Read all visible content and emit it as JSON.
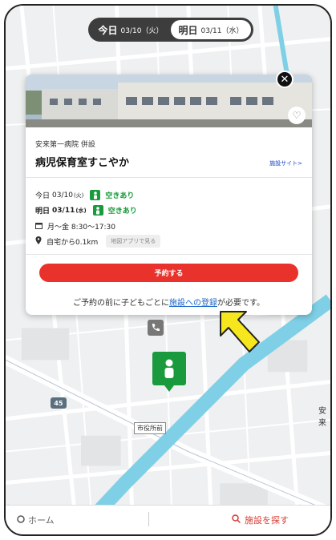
{
  "date_toggle": {
    "today": {
      "label": "今日",
      "date": "03/10（火）"
    },
    "tomorrow": {
      "label": "明日",
      "date": "03/11（水）"
    }
  },
  "facility": {
    "hospital": "安来第一病院 併設",
    "name": "病児保育室すこやか",
    "site_link": "施設サイト>",
    "availability": [
      {
        "day": "今日",
        "date": "03/10",
        "weekday": "(火)",
        "status": "空きあり"
      },
      {
        "day": "明日",
        "date": "03/11",
        "weekday": "(水)",
        "status": "空きあり"
      }
    ],
    "hours": "月〜金 8:30〜17:30",
    "distance": "自宅から0.1km",
    "map_app": "地図アプリで見る",
    "reserve": "予約する",
    "note_before": "ご予約の前に子どもごとに",
    "note_link": "施設への登録",
    "note_after": "が必要です。"
  },
  "map": {
    "route_number": "45",
    "place_label": "市役所前",
    "edge_label": "安来"
  },
  "bottom_nav": {
    "home": "ホーム",
    "search": "施設を探す"
  },
  "colors": {
    "accent_red": "#e8322b",
    "available_green": "#1a9a3c",
    "link_blue": "#1a66c8",
    "toggle_dark": "#3d3d3d",
    "arrow_yellow": "#f5e61e"
  }
}
